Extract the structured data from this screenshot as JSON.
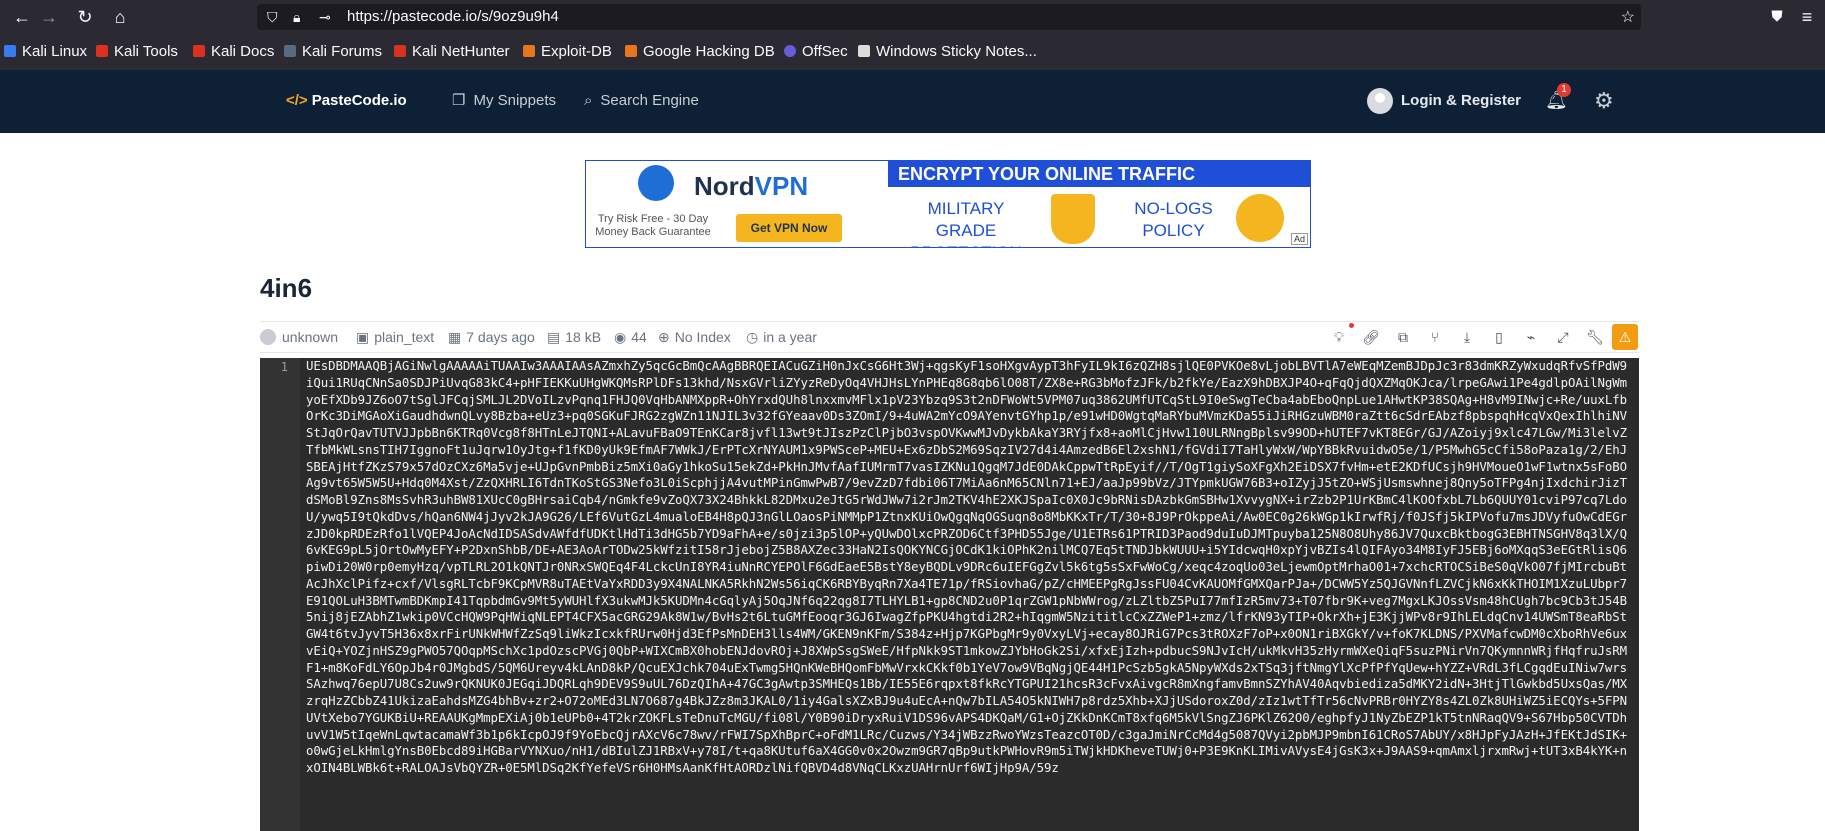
{
  "browser": {
    "url": "https://pastecode.io/s/9oz9u9h4",
    "bookmarks": [
      "Kali Linux",
      "Kali Tools",
      "Kali Docs",
      "Kali Forums",
      "Kali NetHunter",
      "Exploit-DB",
      "Google Hacking DB",
      "OffSec",
      "Windows Sticky Notes..."
    ]
  },
  "header": {
    "logo_prefix": "</>",
    "logo_text": "PasteCode.io",
    "nav": [
      "My Snippets",
      "Search Engine"
    ],
    "login": "Login & Register",
    "notification_count": "1"
  },
  "ad": {
    "brand_a": "Nord",
    "brand_b": "VPN",
    "risk_free": "Try Risk Free - 30 Day Money Back Guarantee",
    "cta": "Get VPN Now",
    "headline": "ENCRYPT YOUR ONLINE TRAFFIC",
    "feature1": "MILITARY GRADE PROTECTION",
    "feature2": "NO-LOGS POLICY",
    "tag": "Ad"
  },
  "paste": {
    "title": "4in6",
    "author": "unknown",
    "syntax": "plain_text",
    "age": "7 days ago",
    "size": "18 kB",
    "views": "44",
    "index": "No Index",
    "expires": "in a year",
    "line_number": "1",
    "content": "UEsDBDMAAQBjAGiNwlgAAAAAiTUAAIw3AAAIAAsAZmxhZy5qcGcBmQcAAgBBRQEIACuGZiH0nJxCsG6Ht3Wj+qgsKyF1soHXgvAypT3hFyIL9kI6zQZH8sjlQE0PVKOe8vLjobLBVTlA7eWEqMZemBJDpJc3r83dmKRZyWxudqRfvSfPdW9iQui1RUqCNnSa0SDJPiUvqG83kC4+pHFIEKKuUHgWKQMsRPlDFs13khd/NsxGVrliZYyzReDyOq4VHJHsLYnPHEq8G8qb6lO08T/ZX8e+RG3bMofzJFk/b2fkYe/EazX9hDBXJP4O+qFqQjdQXZMqOKJca/lrpeGAwi1Pe4gdlpOAilNgWmyoEfXDb9JZ6oO7tSglJFCqjSMLJL2DVoILzvPqnq1FHJQ0VqHbANMXppR+OhYrxdQUh8lnxxmvMFlx1pV23Ybzq9S3t2nDFWoWt5VPM07uq3862UMfUTCqStL9I0eSwgTeCba4abEboQnpLue1AHwtKP38SQAg+H8vM9INwjc+Re/uuxLfbOrKc3DiMGAoXiGaudhdwnQLvy8Bzba+eUz3+pq0SGKuFJRG2zgWZn11NJIL3v32fGYeaav0Ds3ZOmI/9+4uWA2mYcO9AYenvtGYhp1p/e91wHD0WgtqMaRYbuMVmzKDa55iJiRHGzuWBM0raZtt6cSdrEAbzf8pbspqhHcqVxQexIhlhiNVStJqOrQavTUTVJJpbBn6KTRq0Vcg8f8HTnLeJTQNI+ALavuFBaO9TEnKCar8jvfl13wt9tJIszPzClPjbO3vspOVKwwMJvDykbAkaY3RYjfx8+aoMlCjHvw110ULRNngBplsv99OD+hUTEF7vKT8EGr/GJ/AZoiyj9xlc47LGw/Mi3lelvZTfbMkWLsnsTIH7IggnoFt1uJqrw1OyJtg+f1fKD0yUk9EfmAF7WWkJ/ErPTcXrNYAUM1x9PWSceP+MEU+Ex6zDbS2M69SqzIV27d4i4AmzedB6El2xshN1/fGVdiI7TaHlyWxW/WpYBBkRvuidwO5e/1/P5MwhG5cCfi58oPaza1g/2/EhJSBEAjHtfZKzS79x57dOzCXz6Ma5vje+UJpGvnPmbBiz5mXi0aGy1hkoSu15ekZd+PkHnJMvfAafIUMrmT7vasIZKNu1QgqM7JdE0DAkCppwTtRpEyif//T/OgT1giySoXFgXh2EiDSX7fvHm+etE2KDfUCsjh9HVMoueO1wF1wtnx5sFoBOAg9vt65W5W5U+Hdq0M4Xst/ZzQXHRLI6TdnTKoStGS3Nefo3L0iScphjjA4vutMPinGmwPwB7/9evZzD7fdbi06T7MiAa6nM65CNln71+EJ/aaJp99bVz/JTYpmkUGW76B3+oIZyjJ5tZO+WSjUsmswhnej8Qny5oTFPg4njIxdchirJizTdSMoBl9Zns8MsSvhR3uhBW81XUcC0gBHrsaiCqb4/nGmkfe9vZoQX73X24BhkkL82DMxu2eJtG5rWdJWw7i2rJm2TKV4hE2XKJSpaIc0X0Jc9bRNisDAzbkGmSBHw1XvvygNX+irZzb2P1UrKBmC4lKOOfxbL7Lb6QUUY01cviP97cq7LdoU/ywq5I9tQkdDvs/hQan6NW4jJyv2kJA9G26/LEf6VutGzL4mualoEB4H8pQJ3nGlLOaosPiNMMpP1ZtnxKUiOwQgqNqOGSuqn8o8MbKKxTr/T/30+8J9PrOkppeAi/Aw0EC0g26kWGp1kIrwfRj/f0JSfj5kIPVofu7msJDVyfuOwCdEGrzJD0kpRDEzRfo1lVQEP4JoAcNdIDSASdvAWfdfUDKtlHdTi3dHG5b7YD9aFhA+e/s0jzi3p5lOP+yQUwDOlxcPRZOD6Ctf3PHD55Jge/U1ETRs61PTRID3Paod9duIuDJMTpuyba125N8O8Uhy86JV7QuxcBktbogG3EBHTNSGHV8q3lX/Q6vKEG9pL5jOrtOwMyEFY+P2DxnShbB/DE+AE3AoArTODw25kWfzitI58rJjebojZ5B8AXZec33HaN2IsQOKYNCGjOCdK1kiOPhK2nilMCQ7Eq5tTNDJbkWUUU+i5YIdcwqH0xpYjvBZIs4lQIFAyo34M8IyFJ5EBj6oMXqqS3eEGtRlisQ6piwDi20W0rp0emyHzq/vpTLRL2O1kQNTJr0NRxSWQEq4F4LckcUnI8YR4iuNnRCYEPOlF6GdEaeE5BstY8eyBQDLv9DRc6uIEFGgZvl5k6tg5sSxFwWoCg/xeqc4zoqUo03eLjewmOptMrhaO01+7xchcRTOCSiBeS0qVkO07fjMIrcbuBtAcJhXclPifz+cxf/VlsgRLTcbF9KCpMVR8uTAEtVaYxRDD3y9X4NALNKA5RkhN2Ws56iqCK6RBYByqRn7Xa4TE71p/fRSiovhaG/pZ/cHMEEPgRgJssFU04CvKAUOMfGMXQarPJa+/DCWW5Yz5QJGVNnfLZVCjkN6xKkTHOIM1XzuLUbpr7E91QOLuH3BMTwmBDKmpI41TqpbdmGv9Mt5yWUHlfX3ukwMJk5KUDMn4cGqlyAj5OqJNf6q22qg8I7TLHYLB1+gp8CND2u0P1qrZGW1pNbWWrog/zLZltbZ5PuI77mfIzR5mv73+T07fbr9K+veg7MgxLKJOssVsm48hCUgh7bc9Cb3tJ54B5nij8jEZAbhZ1wkip0VCcHQW9PqHWiqNLEPT4CFX5acGRG29Ak8W1w/BvHs2t6LtuGMfEooqr3GJ6IwagZfpPKU4hgtdi2R2+hIqgmW5NzititlcCxZZWeP1+zmz/lfrKN93yTIP+OkrXh+jE3KjjWPv8r9IhLELdqCnv14UWSmT8eaRbStGW4t6tvJyvT5H36x8xrFirUNkWHWfZzSq9liWkzIcxkfRUrw0Hjd3EfPsMnDEH3lls4WM/GKEN9nKFm/S384z+Hjp7KGPbgMr9y0VxyLVj+ecay8OJRiG7Pcs3tROXzF7oP+x0ON1riBXGkY/v+foK7KLDNS/PXVMafcwDM0cXboRhVe6uxvEiQ+YOZjnHSZ9gPWO57QOqpMSchXc1pdOzscPVGj0QbP+WIXCmBX0hobENJdovROj+J8XWpSsgSWeE/HfpNkk9ST1mkowZJYbHoGk2Si/xfxEjIzh+pdbucS9NJvIcH/ukMkvH35zHyrmWXeQiqF5suzPNirVn7QKymnnWRjfHqfruJsRMF1+m8KoFdLY6OpJb4r0JMgbdS/5QM6Ureyv4kLAnD8kP/QcuEXJchk704uExTwmg5HQnKWeBHQomFbMwVrxkCKkf0b1YeV7ow9VBqNgjQE44H1PcSzb5gkA5NpyWXds2xTSq3jftNmgYlXcPfPfYqUew+hYZZ+VRdL3fLCgqdEuINiw7wrsSAzhwq76epU7U8Cs2uw9rQKNUK0JEGqiJDQRLqh9DEV9S9uUL76DzQIhA+47GC3gAwtp3SMHEQs1Bb/IE55E6rqpxt8fkRcYTGPUI21hcsR3cFvxAivgcR8mXngfamvBmnSZYhAV40Aqvbiediza5dMKY2idN+3HtjTlGwkbd5UxsQas/MXzrqHzZCbbZ41UkizaEahdsMZG4bhBv+zr2+O72oMEd3LN7O687g4BkJZz8m3JKAL0/1iy4GalsXZxBJ9u4uEcA+nQw7bILA54O5kNIWH7p8rdz5Xhb+XJjUSdoroxZ0d/zIz1wtTfTr56cNvPRBr0HYZY8s4ZL0Zk8UHiWZ5iECQYs+5FPNUVtXebo7YGUKBiU+REAAUKgMmpEXiAj0b1eUPb0+4T2krZOKFLsTeDnuTcMGU/fi08l/Y0B90iDryxRuiV1DS96vAPS4DKQaM/G1+OjZKkDnKCmT8xfq6M5kVlSngZJ6PKlZ62O0/eghpfyJ1NyZbEZP1kT5tnNRaqQV9+S67Hbp50CVTDhuvV1W5tIqeWnLqwtacamaWf3b1p6kIcpOJ9f9YoEbcQjrAXcV6c78wv/rFWI7SpXhBprC+oFdM1LRc/Cuzws/Y34jWBzzRwoYWzsTeazcOT0D/c3gaJmiNrCcMd4g5087QVyi2pbMJP9mbnI61CRoS7AbUY/x8HJpFyJAzH+JfEKtJdSIK+o0wGjeLkHmlgYnsB0Ebcd89iHGBarVYNXuo/nH1/dBIulZJ1RBxV+y78I/t+qa8KUtuf6aX4GG0v0x2Owzm9GR7qBp9utkPWHovR9m5iTWjkHDKheveTUWj0+P3E9KnKLIMivAVysE4jGsK3x+J9AAS9+qmAmxljrxmRwj+tUT3xB4kYK+nxOIN4BLWBk6t+RALOAJsVbQYZR+0E5MlDSq2KfYefeVSr6H0HMsAanKfHtAORDzlNifQBVD4d8VNqCLKxzUAHrnUrf6WIjHp9A/59z"
  },
  "colors": {
    "header_bg": "#0e2036",
    "code_bg": "#2b2b2b",
    "accent": "#f5a623",
    "warn": "#f39c12"
  }
}
